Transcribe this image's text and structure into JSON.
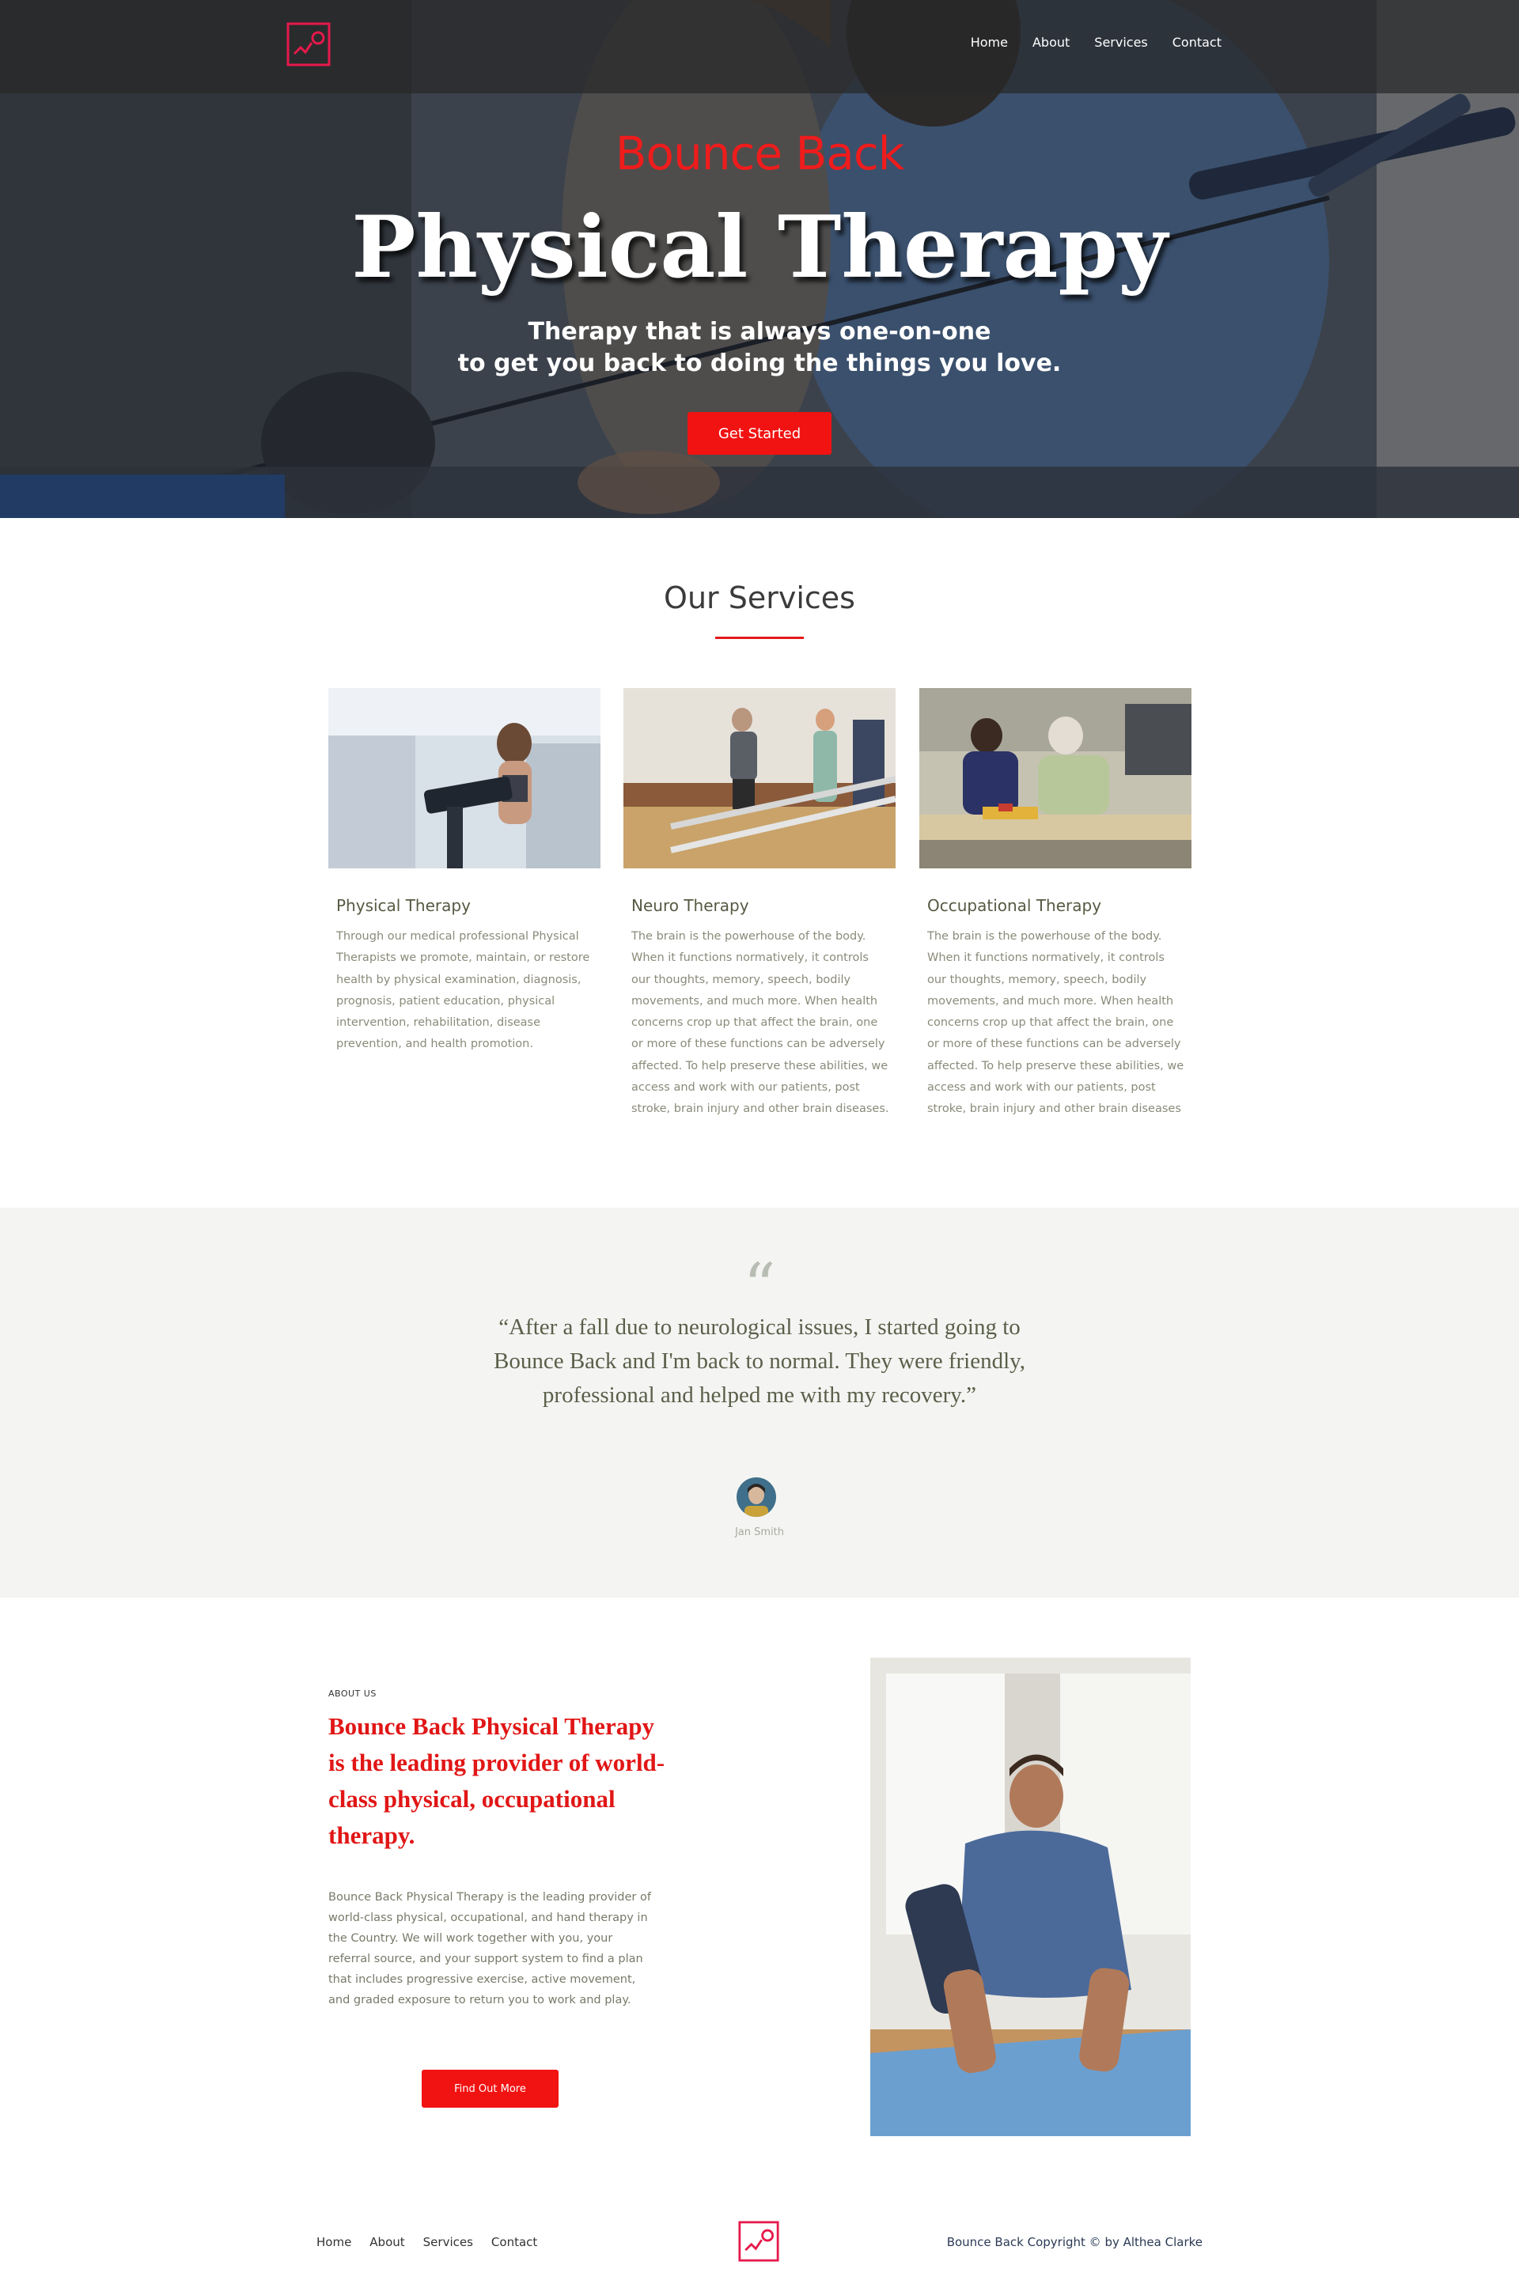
{
  "brand": {
    "accent": "#f11212",
    "logo_color": "#e6194b"
  },
  "nav": {
    "items": [
      "Home",
      "About",
      "Services",
      "Contact"
    ]
  },
  "hero": {
    "kicker": "Bounce Back",
    "title": "Physical Therapy",
    "subtitle_line1": "Therapy that is always one-on-one",
    "subtitle_line2": "to get you back to doing the things you love.",
    "cta": "Get Started"
  },
  "services": {
    "title": "Our Services",
    "cards": [
      {
        "title": "Physical Therapy",
        "text": "Through our medical professional Physical Therapists we promote, maintain, or restore health by physical examination, diagnosis, prognosis, patient education, physical intervention, rehabilitation, disease prevention, and health promotion.",
        "image": "woman-on-elliptical-photo"
      },
      {
        "title": "Neuro Therapy",
        "text": "The brain is the powerhouse of the body. When it functions normatively, it controls our thoughts, memory, speech, bodily movements, and much more. When health concerns crop up that affect the brain, one or more of these functions can be adversely affected. To help preserve these abilities, we access and work with our patients, post stroke, brain injury and other brain diseases.",
        "image": "man-walking-parallel-bars-photo"
      },
      {
        "title": "Occupational Therapy",
        "text": "The brain is the powerhouse of the body. When it functions normatively, it controls our thoughts, memory, speech, bodily movements, and much more. When health concerns crop up that affect the brain, one or more of these functions can be adversely affected. To help preserve these abilities, we access and work with our patients, post stroke, brain injury and other brain diseases",
        "image": "elderly-woman-puzzle-photo"
      }
    ]
  },
  "testimonial": {
    "quote_mark": "“",
    "quote": "“After a fall due to neurological issues, I started going to Bounce Back and I'm back to normal. They were friendly, professional and helped me with my recovery.”",
    "author": "Jan Smith"
  },
  "about": {
    "kicker": "ABOUT US",
    "headline": "Bounce Back Physical Therapy is the leading provider of world-class physical, occupational therapy.",
    "body": "Bounce Back Physical Therapy is the leading provider of world-class physical, occupational, and hand therapy in the Country. We will work together with you, your referral source, and your support system to find a plan that includes progressive exercise, active movement, and graded exposure to return you to work and play.",
    "cta": "Find Out More",
    "image": "man-stretching-on-mat-photo"
  },
  "footer": {
    "links": [
      "Home",
      "About",
      "Services",
      "Contact"
    ],
    "copyright": "Bounce Back Copyright © by Althea Clarke"
  }
}
